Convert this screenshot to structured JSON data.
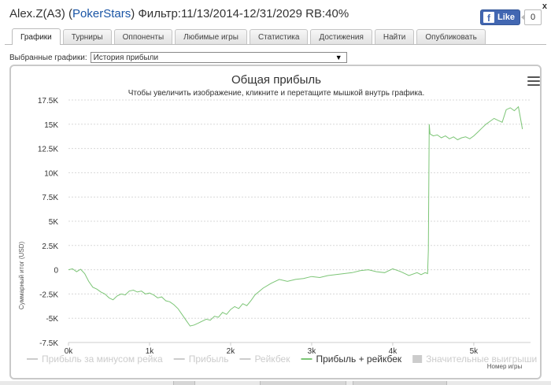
{
  "header": {
    "player": "Alex.Z(A3)",
    "site": "PokerStars",
    "filter": "Фильтр:11/13/2014-12/31/2029 RB:40%",
    "close": "x",
    "like_label": "Like",
    "like_count": "0"
  },
  "tabs": [
    {
      "label": "Графики",
      "active": true
    },
    {
      "label": "Турниры",
      "active": false
    },
    {
      "label": "Оппоненты",
      "active": false
    },
    {
      "label": "Любимые игры",
      "active": false
    },
    {
      "label": "Статистика",
      "active": false
    },
    {
      "label": "Достижения",
      "active": false
    },
    {
      "label": "Найти",
      "active": false
    },
    {
      "label": "Опубликовать",
      "active": false
    }
  ],
  "graph_select": {
    "label": "Выбранные графики:",
    "value": "История прибыли"
  },
  "colors": {
    "line": "#7cc576",
    "grid": "#d8d8d8",
    "legend_inactive": "#cccccc",
    "title": "#333333"
  },
  "chart_data": {
    "type": "line",
    "title": "Общая прибыль",
    "subtitle": "Чтобы увеличить изображение, кликните и перетащите мышкой внутрь графика.",
    "ylabel": "Суммарный итог (USD)",
    "xlabel": "Номер игры",
    "xlim": [
      0,
      5700
    ],
    "ylim": [
      -7500,
      17500
    ],
    "x_ticks": [
      "0k",
      "1k",
      "2k",
      "3k",
      "4k",
      "5k"
    ],
    "y_ticks": [
      "17.5K",
      "15K",
      "12.5K",
      "10K",
      "7.5K",
      "5K",
      "2.5K",
      "0",
      "-2.5K",
      "-5K",
      "-7.5K"
    ],
    "grid": true,
    "legend": [
      {
        "name": "Прибыль за минусом рейка",
        "active": false
      },
      {
        "name": "Прибыль",
        "active": false
      },
      {
        "name": "Рейкбек",
        "active": false
      },
      {
        "name": "Прибыль + рейкбек",
        "active": true
      },
      {
        "name": "Значительные выигрыши",
        "active": false,
        "marker": "square"
      }
    ],
    "series": [
      {
        "name": "Прибыль + рейкбек",
        "x": [
          0,
          50,
          100,
          150,
          200,
          250,
          300,
          350,
          400,
          450,
          500,
          550,
          600,
          650,
          700,
          750,
          800,
          850,
          900,
          950,
          1000,
          1050,
          1100,
          1150,
          1200,
          1250,
          1300,
          1350,
          1400,
          1450,
          1500,
          1550,
          1600,
          1650,
          1700,
          1750,
          1800,
          1850,
          1900,
          1950,
          2000,
          2050,
          2100,
          2150,
          2200,
          2250,
          2300,
          2400,
          2500,
          2600,
          2700,
          2800,
          2900,
          3000,
          3100,
          3200,
          3300,
          3400,
          3500,
          3600,
          3700,
          3800,
          3900,
          4000,
          4100,
          4200,
          4300,
          4350,
          4400,
          4430,
          4440,
          4450,
          4460,
          4500,
          4550,
          4600,
          4650,
          4700,
          4750,
          4800,
          4850,
          4900,
          4950,
          5000,
          5050,
          5100,
          5150,
          5200,
          5250,
          5300,
          5350,
          5400,
          5450,
          5500,
          5550,
          5600
        ],
        "y": [
          0,
          100,
          -200,
          50,
          -400,
          -1200,
          -1800,
          -2000,
          -2300,
          -2500,
          -2900,
          -3100,
          -2700,
          -2500,
          -2600,
          -2200,
          -2100,
          -2300,
          -2200,
          -2500,
          -2400,
          -2600,
          -2900,
          -2800,
          -3200,
          -3300,
          -3600,
          -4000,
          -4600,
          -5200,
          -5800,
          -5700,
          -5500,
          -5300,
          -5100,
          -5200,
          -4800,
          -4900,
          -4400,
          -4600,
          -4100,
          -3800,
          -4000,
          -3500,
          -3700,
          -3200,
          -2600,
          -1900,
          -1400,
          -1000,
          -1200,
          -1000,
          -900,
          -700,
          -800,
          -600,
          -500,
          -400,
          -300,
          -100,
          0,
          -200,
          -300,
          100,
          -200,
          -600,
          -300,
          -500,
          -300,
          -400,
          2000,
          15000,
          14000,
          13800,
          13900,
          13600,
          13800,
          13500,
          13700,
          13400,
          13600,
          13700,
          13500,
          13800,
          14200,
          14600,
          15000,
          15300,
          15600,
          15400,
          15200,
          16500,
          16700,
          16400,
          16800,
          14500
        ]
      }
    ]
  }
}
